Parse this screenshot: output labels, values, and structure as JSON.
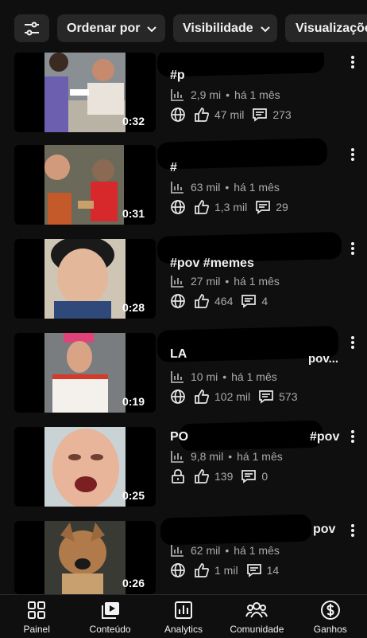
{
  "filters": {
    "sort_label": "Ordenar por",
    "visibility_label": "Visibilidade",
    "views_label": "Visualizações"
  },
  "videos": [
    {
      "title": "#p",
      "duration": "0:32",
      "views": "2,9 mi",
      "age": "há 1 mês",
      "likes": "47 mil",
      "comments": "273",
      "visibility": "public"
    },
    {
      "title": "#",
      "duration": "0:31",
      "views": "63 mil",
      "age": "há 1 mês",
      "likes": "1,3 mil",
      "comments": "29",
      "visibility": "public"
    },
    {
      "title": "#pov #memes",
      "duration": "0:28",
      "views": "27 mil",
      "age": "há 1 mês",
      "likes": "464",
      "comments": "4",
      "visibility": "public"
    },
    {
      "title": "LA",
      "title_tail": "pov...",
      "duration": "0:19",
      "views": "10 mi",
      "age": "há 1 mês",
      "likes": "102 mil",
      "comments": "573",
      "visibility": "public"
    },
    {
      "title": "PO",
      "title_tail": "#pov",
      "duration": "0:25",
      "views": "9,8 mil",
      "age": "há 1 mês",
      "likes": "139",
      "comments": "0",
      "visibility": "private"
    },
    {
      "title": "",
      "title_tail": "pov",
      "duration": "0:26",
      "views": "62 mil",
      "age": "há 1 mês",
      "likes": "1 mil",
      "comments": "14",
      "visibility": "public"
    }
  ],
  "separator": "•",
  "nav": {
    "dashboard": "Painel",
    "content": "Conteúdo",
    "analytics": "Analytics",
    "community": "Comunidade",
    "earnings": "Ganhos"
  },
  "colors": {
    "background": "#0f0f0f",
    "chip": "#272727",
    "text": "#f1f1f1",
    "muted": "#aaaaaa"
  }
}
